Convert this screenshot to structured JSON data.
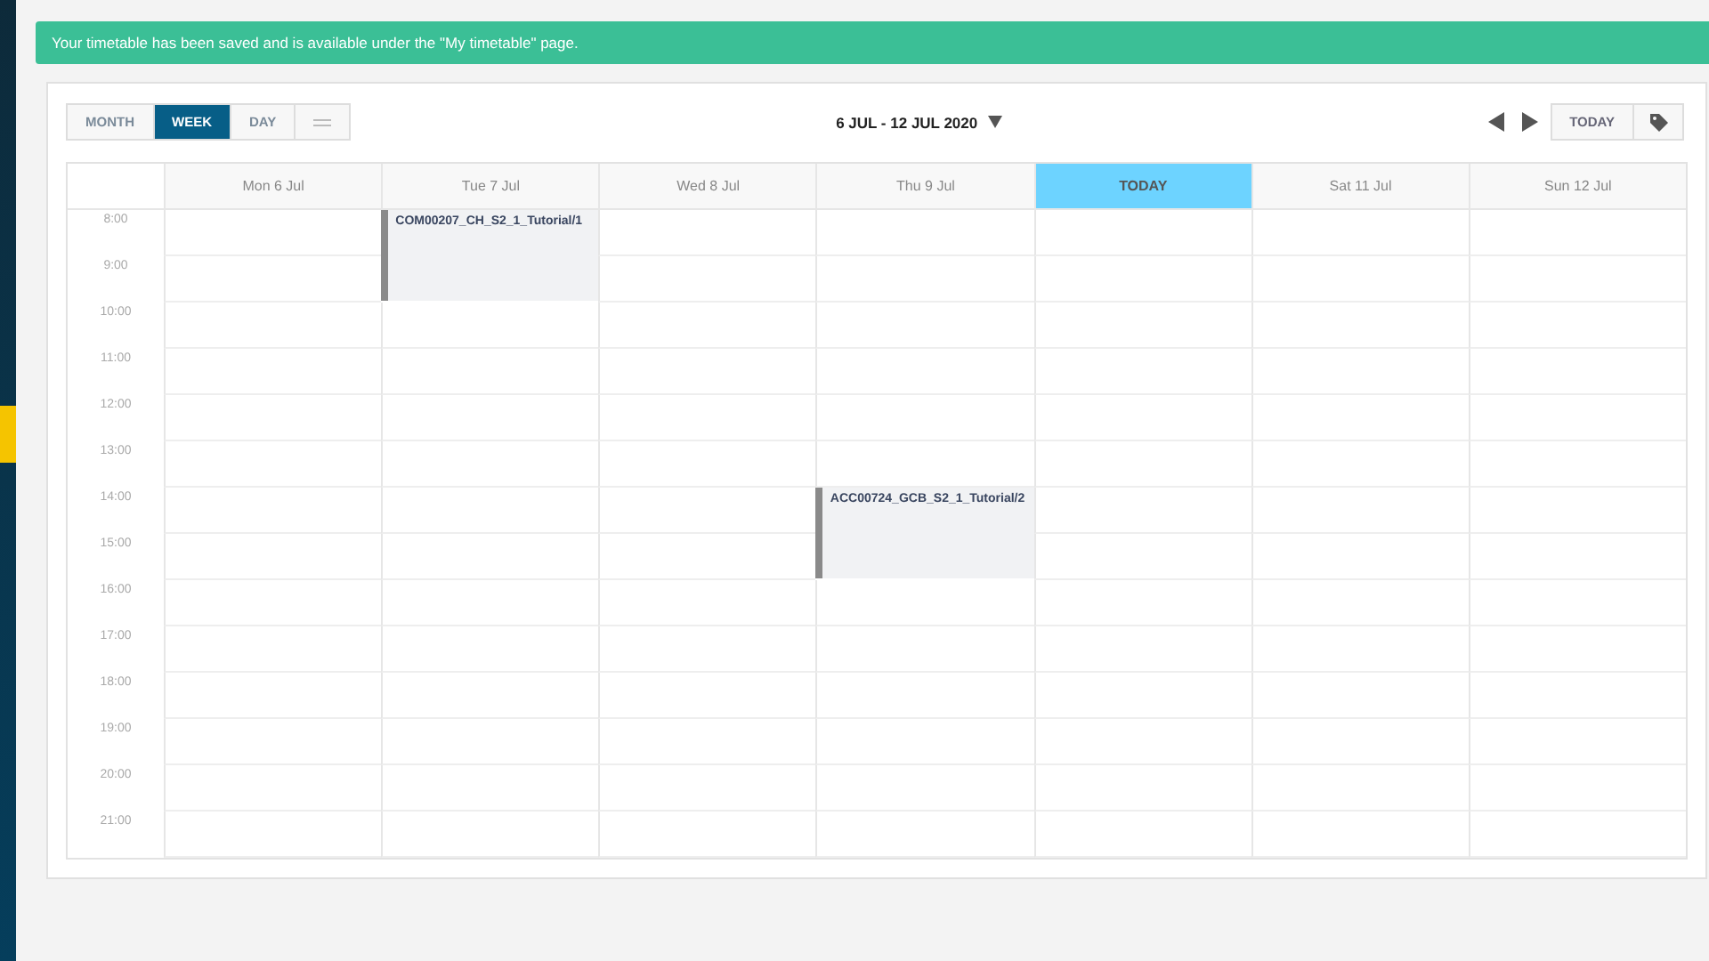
{
  "banner": {
    "message": "Your timetable has been saved and is available under the \"My timetable\" page."
  },
  "view_tabs": [
    {
      "label": "MONTH",
      "selected": false
    },
    {
      "label": "WEEK",
      "selected": true
    },
    {
      "label": "DAY",
      "selected": false
    },
    {
      "kind": "list",
      "selected": false
    }
  ],
  "date_range": {
    "label": "6 JUL - 12 JUL 2020"
  },
  "today_button": {
    "label": "TODAY"
  },
  "days": [
    {
      "label": "Mon 6 Jul",
      "today": false
    },
    {
      "label": "Tue 7 Jul",
      "today": false
    },
    {
      "label": "Wed 8 Jul",
      "today": false
    },
    {
      "label": "Thu 9 Jul",
      "today": false
    },
    {
      "label": "TODAY",
      "today": true
    },
    {
      "label": "Sat 11 Jul",
      "today": false
    },
    {
      "label": "Sun 12 Jul",
      "today": false
    }
  ],
  "hours": [
    {
      "label": "8:00",
      "slots": [
        {
          "kind": "empty"
        },
        {
          "kind": "event",
          "title": "COM00207_CH_S2_1_Tutorial/1"
        },
        {
          "kind": "empty"
        },
        {
          "kind": "empty"
        },
        {
          "kind": "empty"
        },
        {
          "kind": "empty"
        },
        {
          "kind": "empty"
        }
      ]
    },
    {
      "label": "9:00",
      "slots": [
        {
          "kind": "empty"
        },
        {
          "kind": "continued"
        },
        {
          "kind": "empty"
        },
        {
          "kind": "empty"
        },
        {
          "kind": "empty"
        },
        {
          "kind": "empty"
        },
        {
          "kind": "empty"
        }
      ]
    },
    {
      "label": "10:00",
      "slots": [
        {
          "kind": "empty"
        },
        {
          "kind": "empty"
        },
        {
          "kind": "empty"
        },
        {
          "kind": "empty"
        },
        {
          "kind": "empty"
        },
        {
          "kind": "empty"
        },
        {
          "kind": "empty"
        }
      ]
    },
    {
      "label": "11:00",
      "slots": [
        {
          "kind": "empty"
        },
        {
          "kind": "empty"
        },
        {
          "kind": "empty"
        },
        {
          "kind": "empty"
        },
        {
          "kind": "empty"
        },
        {
          "kind": "empty"
        },
        {
          "kind": "empty"
        }
      ]
    },
    {
      "label": "12:00",
      "slots": [
        {
          "kind": "empty"
        },
        {
          "kind": "empty"
        },
        {
          "kind": "empty"
        },
        {
          "kind": "empty"
        },
        {
          "kind": "empty"
        },
        {
          "kind": "empty"
        },
        {
          "kind": "empty"
        }
      ]
    },
    {
      "label": "13:00",
      "slots": [
        {
          "kind": "empty"
        },
        {
          "kind": "empty"
        },
        {
          "kind": "empty"
        },
        {
          "kind": "empty"
        },
        {
          "kind": "empty"
        },
        {
          "kind": "empty"
        },
        {
          "kind": "empty"
        }
      ]
    },
    {
      "label": "14:00",
      "slots": [
        {
          "kind": "empty"
        },
        {
          "kind": "empty"
        },
        {
          "kind": "empty"
        },
        {
          "kind": "event",
          "title": "ACC00724_GCB_S2_1_Tutorial/2"
        },
        {
          "kind": "empty"
        },
        {
          "kind": "empty"
        },
        {
          "kind": "empty"
        }
      ]
    },
    {
      "label": "15:00",
      "slots": [
        {
          "kind": "empty"
        },
        {
          "kind": "empty"
        },
        {
          "kind": "empty"
        },
        {
          "kind": "continued"
        },
        {
          "kind": "empty"
        },
        {
          "kind": "empty"
        },
        {
          "kind": "empty"
        }
      ]
    },
    {
      "label": "16:00",
      "slots": [
        {
          "kind": "empty"
        },
        {
          "kind": "empty"
        },
        {
          "kind": "empty"
        },
        {
          "kind": "empty"
        },
        {
          "kind": "empty"
        },
        {
          "kind": "empty"
        },
        {
          "kind": "empty"
        }
      ]
    },
    {
      "label": "17:00",
      "slots": [
        {
          "kind": "empty"
        },
        {
          "kind": "empty"
        },
        {
          "kind": "empty"
        },
        {
          "kind": "empty"
        },
        {
          "kind": "empty"
        },
        {
          "kind": "empty"
        },
        {
          "kind": "empty"
        }
      ]
    },
    {
      "label": "18:00",
      "slots": [
        {
          "kind": "empty"
        },
        {
          "kind": "empty"
        },
        {
          "kind": "empty"
        },
        {
          "kind": "empty"
        },
        {
          "kind": "empty"
        },
        {
          "kind": "empty"
        },
        {
          "kind": "empty"
        }
      ]
    },
    {
      "label": "19:00",
      "slots": [
        {
          "kind": "empty"
        },
        {
          "kind": "empty"
        },
        {
          "kind": "empty"
        },
        {
          "kind": "empty"
        },
        {
          "kind": "empty"
        },
        {
          "kind": "empty"
        },
        {
          "kind": "empty"
        }
      ]
    },
    {
      "label": "20:00",
      "slots": [
        {
          "kind": "empty"
        },
        {
          "kind": "empty"
        },
        {
          "kind": "empty"
        },
        {
          "kind": "empty"
        },
        {
          "kind": "empty"
        },
        {
          "kind": "empty"
        },
        {
          "kind": "empty"
        }
      ]
    },
    {
      "label": "21:00",
      "slots": [
        {
          "kind": "empty"
        },
        {
          "kind": "empty"
        },
        {
          "kind": "empty"
        },
        {
          "kind": "empty"
        },
        {
          "kind": "empty"
        },
        {
          "kind": "empty"
        },
        {
          "kind": "empty"
        }
      ]
    }
  ]
}
